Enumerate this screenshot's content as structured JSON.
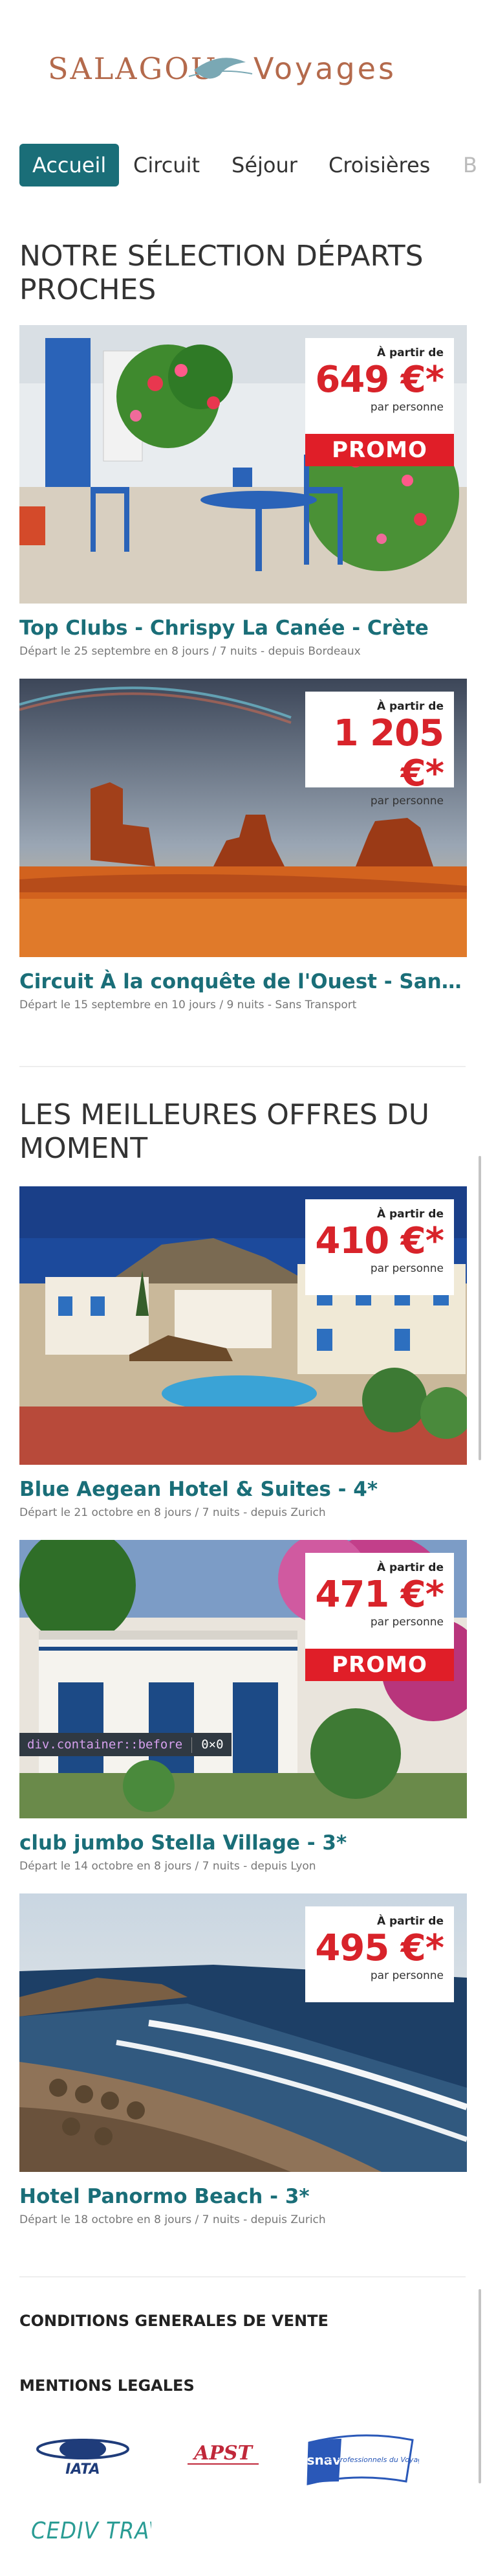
{
  "brand": {
    "logo_text_left": "SALAGOU",
    "logo_text_right": "Voyages",
    "logo_color": "#b46a4c",
    "logo_wave_color": "#7aa8b4"
  },
  "nav": {
    "items": [
      "Accueil",
      "Circuit",
      "Séjour",
      "Croisières",
      "B"
    ],
    "active_index": 0,
    "accent_color": "#1a6e78"
  },
  "sections": [
    {
      "title": "NOTRE SÉLECTION DÉPARTS PROCHES",
      "offers": [
        {
          "from_label": "À partir de",
          "price": "649 €*",
          "per_label": "par personne",
          "promo": "PROMO",
          "title": "Top Clubs - Chrispy La Canée - Crète",
          "info": "Départ le 25 septembre en 8 jours / 7 nuits - depuis Bordeaux"
        },
        {
          "from_label": "À partir de",
          "price": "1 205 €*",
          "per_label": "par personne",
          "title": "Circuit À la conquête de l'Ouest - Sans transport",
          "info": "Départ le 15 septembre en 10 jours / 9 nuits - Sans Transport"
        }
      ]
    },
    {
      "title": "LES MEILLEURES OFFRES DU MOMENT",
      "offers": [
        {
          "from_label": "À partir de",
          "price": "410 €*",
          "per_label": "par personne",
          "title": "Blue Aegean Hotel & Suites - 4*",
          "info": "Départ le 21 octobre en 8 jours / 7 nuits - depuis Zurich"
        },
        {
          "from_label": "À partir de",
          "price": "471 €*",
          "per_label": "par personne",
          "promo": "PROMO",
          "title": "club jumbo Stella Village - 3*",
          "info": "Départ le 14 octobre en 8 jours / 7 nuits - depuis Lyon"
        },
        {
          "from_label": "À partir de",
          "price": "495 €*",
          "per_label": "par personne",
          "title": "Hotel Panormo Beach - 3*",
          "info": "Départ le 18 octobre en 8 jours / 7 nuits - depuis Zurich"
        }
      ]
    }
  ],
  "devtools_tag": {
    "selector": "div.container::before",
    "size": "0×0"
  },
  "footer": {
    "cgv": "CONDITIONS GENERALES DE VENTE",
    "legal": "MENTIONS LEGALES",
    "partners": [
      {
        "name": "IATA",
        "icon": "iata-logo"
      },
      {
        "name": "APST",
        "icon": "apst-logo"
      },
      {
        "name": "snav",
        "subtitle": "les Professionnels du Voyage",
        "icon": "snav-logo"
      },
      {
        "name": "CEDIV TRAVEL",
        "icon": "cediv-logo"
      }
    ]
  },
  "colors": {
    "price_red": "#d8232a",
    "promo_red": "#e01e28",
    "title_teal": "#1a6e78"
  }
}
